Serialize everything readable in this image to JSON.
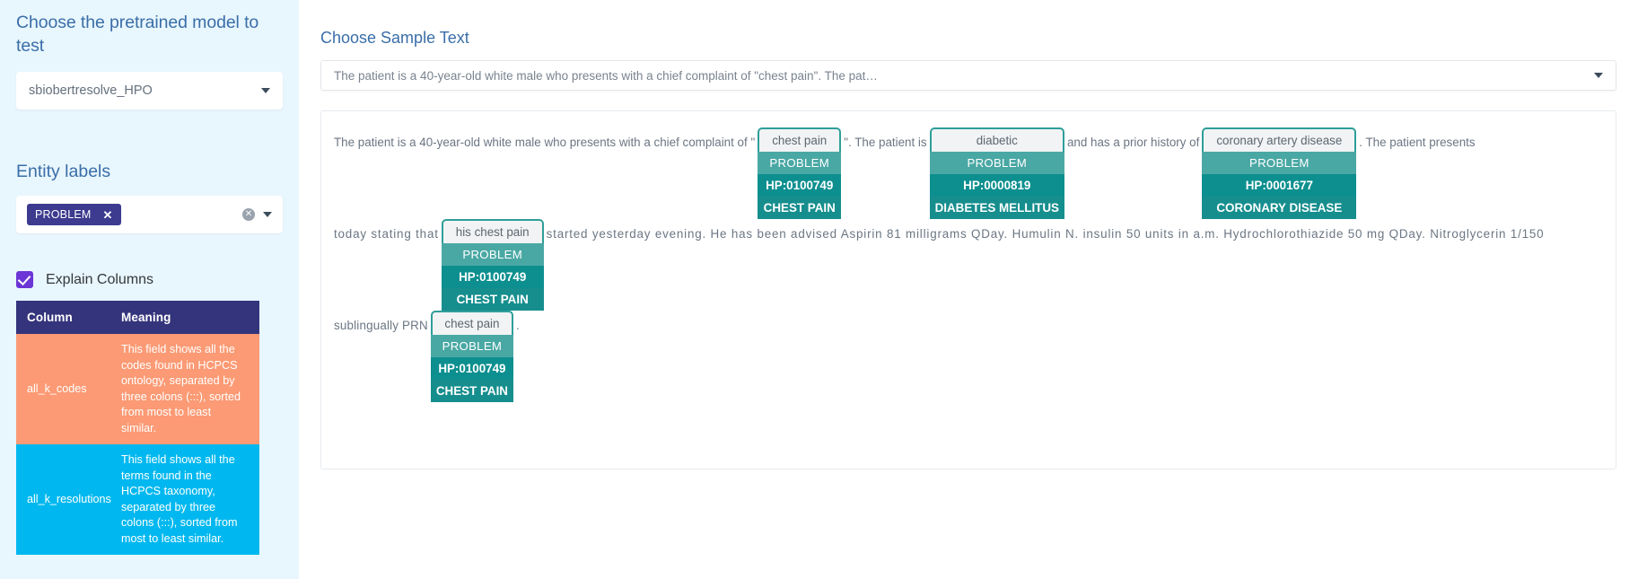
{
  "sidebar": {
    "model_title": "Choose the pretrained model to test",
    "model_select": {
      "value": "sbiobertresolve_HPO",
      "icon": "chevron-down-icon"
    },
    "entity_labels_title": "Entity labels",
    "tags": [
      {
        "label": "PROBLEM",
        "remove_icon": "close-icon"
      }
    ],
    "tags_clear_icon": "clear-circle-icon",
    "tags_caret_icon": "chevron-down-icon",
    "explain_columns": {
      "label": "Explain Columns",
      "checked": true
    },
    "table": {
      "headers": [
        "Column",
        "Meaning"
      ],
      "rows": [
        {
          "column": "all_k_codes",
          "meaning": "This field shows all the codes found in HCPCS ontology, separated by three colons (:::), sorted from most to least similar.",
          "color": "#fb9a74"
        },
        {
          "column": "all_k_resolutions",
          "meaning": "This field shows all the terms found in the HCPCS taxonomy, separated by three colons (:::), sorted from most to least similar.",
          "color": "#00b8ef"
        }
      ]
    }
  },
  "main": {
    "title": "Choose Sample Text",
    "sample_select": {
      "value": "The patient is a 40-year-old white male who presents with a chief complaint of \"chest pain\". The pat…",
      "icon": "chevron-down-icon"
    },
    "annotated_lines": [
      {
        "parts": [
          {
            "type": "text",
            "text": "The patient is a 40-year-old white male who presents with a chief complaint of \""
          },
          {
            "type": "entity",
            "text": "chest pain",
            "label": "PROBLEM",
            "code": "HP:0100749",
            "resolution": "CHEST PAIN"
          },
          {
            "type": "text",
            "text": "\". The patient is"
          },
          {
            "type": "entity",
            "text": "diabetic",
            "label": "PROBLEM",
            "code": "HP:0000819",
            "resolution": "DIABETES MELLITUS"
          },
          {
            "type": "text",
            "text": "and has a prior history of"
          },
          {
            "type": "entity",
            "text": "coronary artery disease",
            "label": "PROBLEM",
            "code": "HP:0001677",
            "resolution": "CORONARY DISEASE"
          },
          {
            "type": "text",
            "text": ". The patient presents"
          }
        ]
      },
      {
        "parts": [
          {
            "type": "text",
            "text": "today stating that"
          },
          {
            "type": "entity",
            "text": "his chest pain",
            "label": "PROBLEM",
            "code": "HP:0100749",
            "resolution": "CHEST PAIN"
          },
          {
            "type": "text",
            "text": "started yesterday evening. He has been advised Aspirin 81 milligrams QDay. Humulin N. insulin 50 units in a.m. Hydrochlorothiazide 50 mg QDay. Nitroglycerin 1/150"
          }
        ]
      },
      {
        "parts": [
          {
            "type": "text",
            "text": "sublingually PRN"
          },
          {
            "type": "entity",
            "text": "chest pain",
            "label": "PROBLEM",
            "code": "HP:0100749",
            "resolution": "CHEST PAIN"
          },
          {
            "type": "text",
            "text": "."
          }
        ]
      }
    ]
  },
  "colors": {
    "sidebar_bg": "#e8f6fd",
    "heading": "#3a6ea8",
    "tag_bg": "#3c3b8f",
    "table_header_bg": "#34347c",
    "entity_border": "#2f9e9a",
    "entity_label_bg": "#4aa8a4",
    "entity_code_bg": "#0d8f8f",
    "checkbox": "#6c35d6"
  }
}
